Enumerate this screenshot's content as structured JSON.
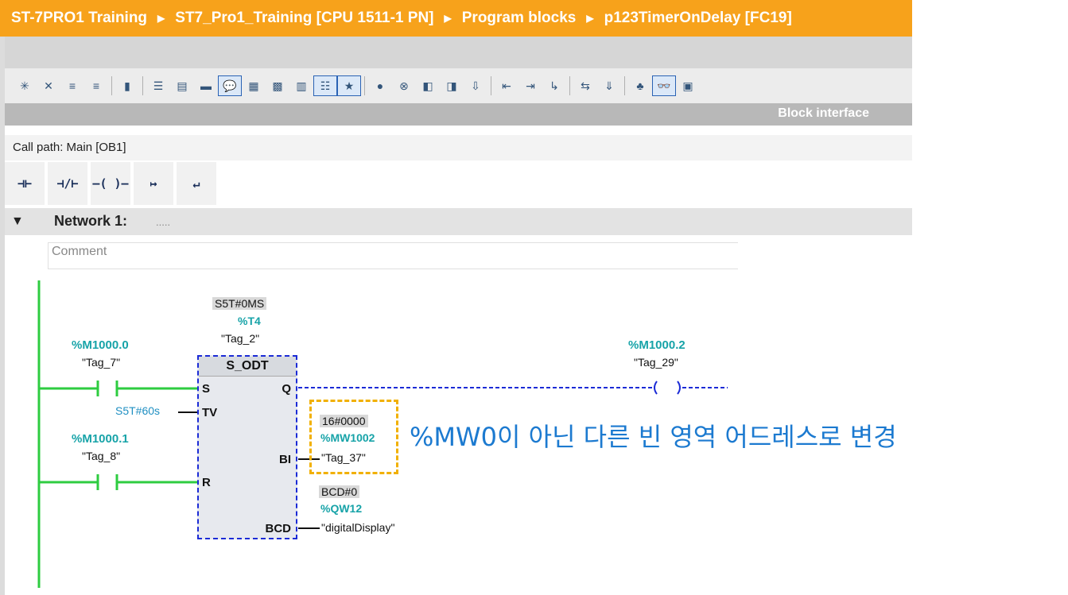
{
  "breadcrumb": [
    "ST-7PRO1 Training",
    "ST7_Pro1_Training [CPU 1511-1 PN]",
    "Program blocks",
    "p123TimerOnDelay [FC19]"
  ],
  "breadcrumb_sep": "▶",
  "toolbar_icons": [
    "network-insert-icon",
    "network-delete-icon",
    "insert-row-icon",
    "add-row-icon",
    "absolute-operand-icon",
    "expand-icon",
    "collapse-icon",
    "open-all-icon",
    "comments-icon",
    "favorites-icon",
    "symbol-info-icon",
    "operand-representation-icon",
    "list-icon",
    "favorites-toggle-icon",
    "breakpoint-icon",
    "clear-breakpoints-icon",
    "monitor-icon",
    "modify-icon",
    "force-icon",
    "prev-error-icon",
    "next-error-icon",
    "goto-icon",
    "compare-icon",
    "download-icon",
    "library-icon",
    "monitoring-on-off-icon",
    "lock-icon"
  ],
  "block_interface": "Block interface",
  "call_path": "Call path: Main [OB1]",
  "ladder_buttons": [
    {
      "name": "normally-open-contact-icon",
      "glyph": "⊣⊢"
    },
    {
      "name": "normally-closed-contact-icon",
      "glyph": "⊣/⊢"
    },
    {
      "name": "output-coil-icon",
      "glyph": "–( )–"
    },
    {
      "name": "open-branch-icon",
      "glyph": "↦"
    },
    {
      "name": "close-branch-icon",
      "glyph": "↵"
    }
  ],
  "network": {
    "title": "Network 1:",
    "dots": ".....",
    "comment_placeholder": "Comment"
  },
  "timer": {
    "preset_value": "S5T#0MS",
    "address": "%T4",
    "tag": "\"Tag_2\"",
    "type": "S_ODT",
    "pins": {
      "s": "S",
      "tv": "TV",
      "r": "R",
      "q": "Q",
      "bi": "BI",
      "bcd": "BCD"
    }
  },
  "contact_s": {
    "address": "%M1000.0",
    "tag": "\"Tag_7\""
  },
  "contact_r": {
    "address": "%M1000.1",
    "tag": "\"Tag_8\""
  },
  "tv_value": "S5T#60s",
  "coil_q": {
    "address": "%M1000.2",
    "tag": "\"Tag_29\""
  },
  "bi_out": {
    "value": "16#0000",
    "address": "%MW1002",
    "tag": "\"Tag_37\""
  },
  "bcd_out": {
    "value": "BCD#0",
    "address": "%QW12",
    "tag": "\"digitalDisplay\""
  },
  "annotation": "%MW0이 아닌 다른 빈 영역 어드레스로 변경",
  "colors": {
    "title_bar": "#f7a21b",
    "power_rail": "#2ecc40",
    "rlo_dashed": "#1b2bd6",
    "highlight": "#f1b000",
    "teal_text": "#17a3a8",
    "note_text": "#1c7ad0"
  }
}
